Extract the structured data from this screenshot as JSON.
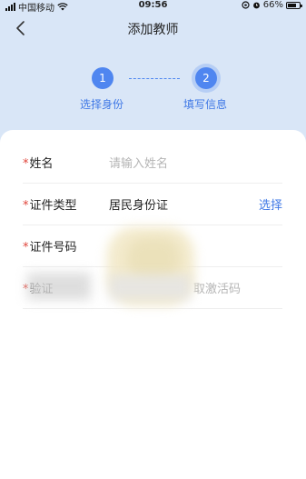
{
  "status_bar": {
    "carrier": "中国移动",
    "time": "09:56",
    "battery_percent": "66%"
  },
  "nav": {
    "title": "添加教师"
  },
  "steps": [
    {
      "number": "1",
      "label": "选择身份"
    },
    {
      "number": "2",
      "label": "填写信息"
    }
  ],
  "form": {
    "name_label": "姓名",
    "name_placeholder": "请输入姓名",
    "id_type_label": "证件类型",
    "id_type_value": "居民身份证",
    "id_type_action": "选择",
    "id_number_label": "证件号码",
    "activation_label": "验证",
    "activation_placeholder": "取激活码",
    "required_mark": "*"
  },
  "colors": {
    "accent": "#4f86f0",
    "link": "#3f78e6",
    "required": "#e0443a",
    "header_bg": "#d9e6f7"
  },
  "icons": [
    "signal-icon",
    "wifi-icon",
    "alarm-icon",
    "battery-icon",
    "back-chevron-icon"
  ]
}
